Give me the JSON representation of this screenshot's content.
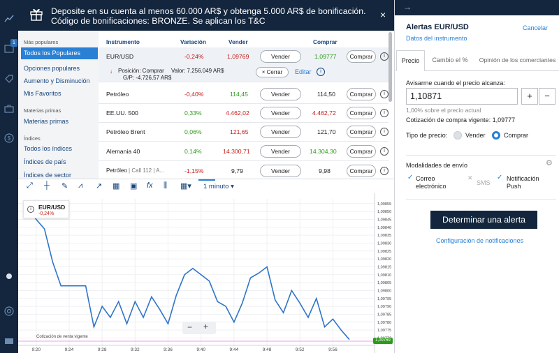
{
  "rail": {
    "badge": "1"
  },
  "banner": {
    "text": "Deposite en su cuenta al menos 60.000 AR$ y obtenga 5.000 AR$ de bonificación. Código de bonificaciones: BRONZE. Se aplican los T&C",
    "close": "×"
  },
  "categories": {
    "popular_header": "Más populares",
    "popular": [
      "Todos los Populares",
      "Opciones populares",
      "Aumento y Disminución",
      "Mis Favoritos"
    ],
    "commodities_header": "Materias primas",
    "commodities": [
      "Materias primas"
    ],
    "indices_header": "Índices",
    "indices": [
      "Todos los índices",
      "Índices de país",
      "Índices de sector"
    ]
  },
  "markets": {
    "headers": {
      "instrument": "Instrumento",
      "change": "Variación",
      "sell": "Vender",
      "buy": "Comprar"
    },
    "rows": [
      {
        "name": "EUR/USD",
        "change": "-0,24%",
        "sell": "1,09769",
        "buy": "1,09777",
        "sell_btn": "Vender",
        "buy_btn": "Comprar"
      },
      {
        "name": "Petróleo",
        "change": "-0,40%",
        "sell": "114,45",
        "buy": "114,50",
        "sell_btn": "Vender",
        "buy_btn": "Comprar"
      },
      {
        "name": "EE.UU. 500",
        "change": "0,33%",
        "sell": "4.462,02",
        "buy": "4.462,72",
        "sell_btn": "Vender",
        "buy_btn": "Comprar"
      },
      {
        "name": "Petróleo Brent",
        "change": "0,06%",
        "sell": "121,65",
        "buy": "121,70",
        "sell_btn": "Vender",
        "buy_btn": "Comprar"
      },
      {
        "name": "Alemania 40",
        "change": "0,14%",
        "sell": "14.300,71",
        "buy": "14.304,30",
        "sell_btn": "Vender",
        "buy_btn": "Comprar"
      },
      {
        "name": "Petróleo",
        "sub": "| Call 112 | A...",
        "change": "-1,15%",
        "sell": "9,79",
        "buy": "9,98",
        "sell_btn": "Vender",
        "buy_btn": "Comprar"
      }
    ],
    "position": {
      "label": "Posición: Comprar",
      "value": "Valor: 7.256.049 AR$",
      "pl": "G/P: -4.726,57 AR$",
      "close_btn": "× Cerrar",
      "edit": "Editar"
    }
  },
  "chart": {
    "timeframe": "1 minuto",
    "legend_symbol": "EUR/USD",
    "legend_change": "-0,24%",
    "ref_line_label": "Cotización de venta vigente",
    "current_price": "1,09769",
    "zoom_minus": "−",
    "zoom_plus": "+"
  },
  "chart_data": {
    "type": "line",
    "x_ticks": [
      "9:20",
      "9:24",
      "9:28",
      "9:32",
      "9:36",
      "9:40",
      "9:44",
      "9:48",
      "9:52",
      "9:56"
    ],
    "y_ticks": [
      "1,09855",
      "1,09850",
      "1,09845",
      "1,09840",
      "1,09835",
      "1,09830",
      "1,09825",
      "1,09820",
      "1,09815",
      "1,09810",
      "1,09805",
      "1,09800",
      "1,09795",
      "1,09790",
      "1,09785",
      "1,09780",
      "1,09775",
      "1,09770"
    ],
    "ylim": [
      1.09768,
      1.09858
    ],
    "x": [
      0,
      1,
      2,
      3,
      4,
      5,
      6,
      7,
      8,
      9,
      10,
      11,
      12,
      13,
      14,
      15,
      16,
      17,
      18,
      19,
      20,
      21,
      22,
      23,
      24,
      25,
      26,
      27,
      28,
      29,
      30,
      31,
      32,
      33,
      34,
      35,
      36,
      37,
      38,
      39
    ],
    "x_labels_index": [
      1,
      5,
      9,
      13,
      17,
      21,
      25,
      29,
      33,
      37
    ],
    "series": [
      {
        "values": [
          1.09852,
          1.09845,
          1.09839,
          1.09818,
          1.09803,
          1.09803,
          1.09803,
          1.09803,
          1.09777,
          1.0979,
          1.09783,
          1.09793,
          1.09779,
          1.09793,
          1.09783,
          1.09796,
          1.09788,
          1.09779,
          1.09797,
          1.0981,
          1.09814,
          1.0981,
          1.09806,
          1.09793,
          1.0979,
          1.0978,
          1.09792,
          1.09808,
          1.09811,
          1.09815,
          1.09794,
          1.09786,
          1.098,
          1.09792,
          1.09783,
          1.09795,
          1.09777,
          1.09782,
          1.09775,
          1.09769
        ]
      }
    ],
    "ref_line_value": 1.09769
  },
  "alert_panel": {
    "title": "Alertas EUR/USD",
    "cancel": "Cancelar",
    "instrument_data": "Datos del instrumento",
    "tabs": [
      "Precio",
      "Cambio el %",
      "Opinión de los comerciantes"
    ],
    "notify_label": "Avisarme cuando el precio alcanza:",
    "price_value": "1,10871",
    "plus": "+",
    "minus": "−",
    "above_text": "1,00% sobre el precio actual",
    "buy_quote_label": "Cotización de compra vigente:",
    "buy_quote_value": "1,09777",
    "price_type_label": "Tipo de precio:",
    "price_type_sell": "Vender",
    "price_type_buy": "Comprar",
    "delivery_label": "Modalidades de envío",
    "delivery_email": "Correo electrónico",
    "delivery_sms": "SMS",
    "delivery_push": "Notificación Push",
    "set_alert": "Determinar una alerta",
    "notif_settings": "Configuración de notificaciones"
  },
  "colors": {
    "navy": "#13263d",
    "accent": "#2a80d4",
    "line": "#2f74c9",
    "negative": "#c3201b",
    "positive": "#2e9a1c"
  }
}
